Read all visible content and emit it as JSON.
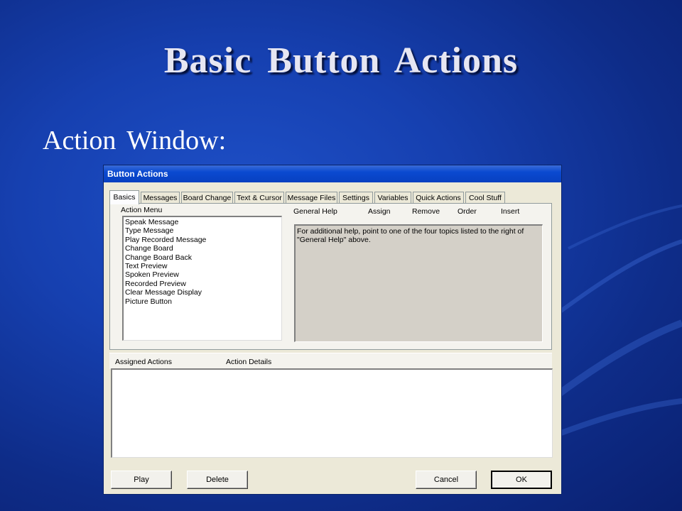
{
  "slide": {
    "title": "Basic  Button  Actions",
    "subtitle": "Action  Window:"
  },
  "window": {
    "title": "Button Actions",
    "tabs": [
      {
        "label": "Basics",
        "active": true
      },
      {
        "label": "Messages"
      },
      {
        "label": "Board Change"
      },
      {
        "label": "Text & Cursor"
      },
      {
        "label": "Message Files"
      },
      {
        "label": "Settings"
      },
      {
        "label": "Variables"
      },
      {
        "label": "Quick Actions"
      },
      {
        "label": "Cool Stuff"
      }
    ],
    "action_menu": {
      "label": "Action Menu",
      "items": [
        "Speak Message",
        "Type Message",
        "Play Recorded Message",
        "Change Board",
        "Change Board Back",
        "Text Preview",
        "Spoken Preview",
        "Recorded Preview",
        "Clear Message Display",
        "Picture Button"
      ]
    },
    "help_topics": {
      "general_help": "General Help",
      "assign": "Assign",
      "remove": "Remove",
      "order": "Order",
      "insert": "Insert"
    },
    "help_text": "For additional help, point to one of the four topics listed to the right of \"General Help\" above.",
    "assigned_actions_label": "Assigned Actions",
    "action_details_label": "Action Details",
    "buttons": {
      "play": "Play",
      "delete": "Delete",
      "cancel": "Cancel",
      "ok": "OK"
    }
  },
  "colors": {
    "background": "#1640b0",
    "titlebar": "#0a49d0",
    "window_face": "#ece9d8"
  }
}
